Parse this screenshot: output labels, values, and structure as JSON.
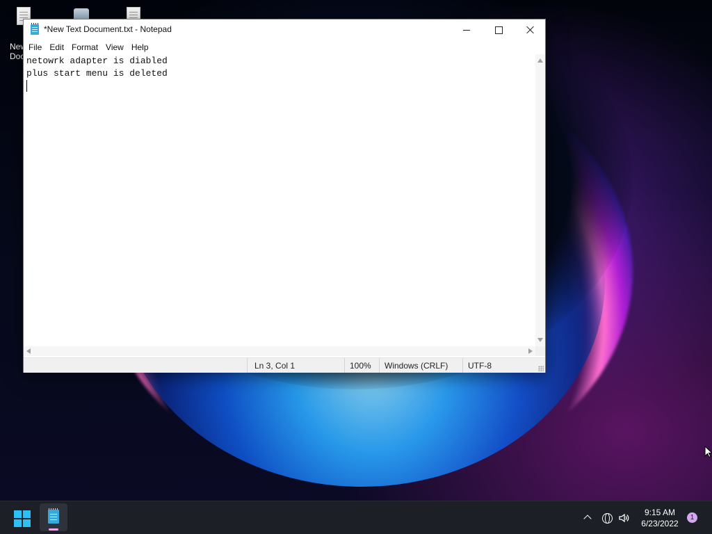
{
  "desktop": {
    "icons": [
      {
        "label": "New Docu",
        "icon": "text-document-icon"
      },
      {
        "label": "",
        "icon": "recycle-bin-icon"
      },
      {
        "label": "",
        "icon": "text-document-icon"
      }
    ]
  },
  "window": {
    "title": "*New Text Document.txt - Notepad",
    "app_icon": "notepad-icon",
    "controls": {
      "minimize": "minimize-icon",
      "maximize": "maximize-icon",
      "close": "close-icon"
    },
    "menu": [
      "File",
      "Edit",
      "Format",
      "View",
      "Help"
    ],
    "editor": {
      "lines": [
        "netowrk adapter is diabled",
        "plus start menu is deleted",
        ""
      ]
    },
    "statusbar": {
      "position": "Ln 3, Col 1",
      "zoom": "100%",
      "line_ending": "Windows (CRLF)",
      "encoding": "UTF-8"
    }
  },
  "taskbar": {
    "start_icon": "windows-start-icon",
    "running_app_icon": "notepad-icon",
    "tray": {
      "icons": [
        "chevron-up-icon",
        "globe-network-icon",
        "speaker-icon"
      ],
      "time": "9:15 AM",
      "date": "6/23/2022",
      "notification_count": "1"
    }
  },
  "colors": {
    "accent": "#2ec0f5",
    "taskbar_bg": "#1c1f26",
    "notification_badge": "#d6a6ef"
  }
}
